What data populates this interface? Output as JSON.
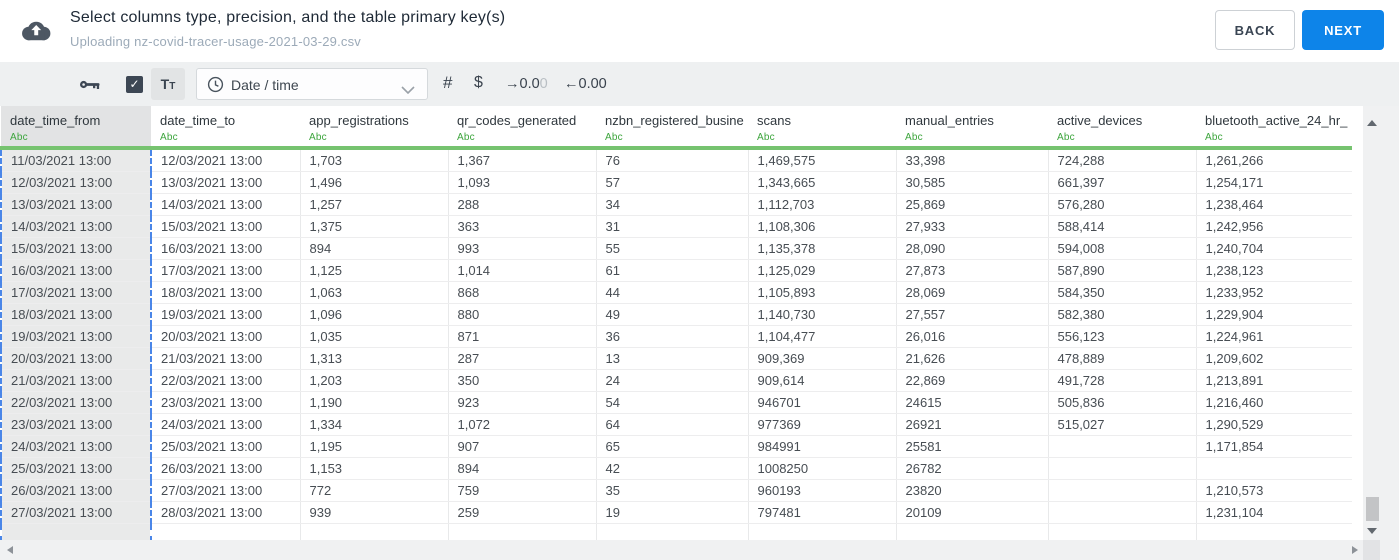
{
  "header": {
    "title": "Select columns type, precision, and the table primary key(s)",
    "subtitle": "Uploading nz-covid-tracer-usage-2021-03-29.csv",
    "back_label": "BACK",
    "next_label": "NEXT"
  },
  "toolbar": {
    "primary_key_icon": "key-icon",
    "checkbox_checked": true,
    "checkbox_glyph": "✓",
    "text_type_big": "T",
    "text_type_small": "T",
    "type_dropdown": {
      "icon": "clock-icon",
      "selected": "Date / time"
    },
    "number_label": "#",
    "currency_label": "$",
    "decimal_right": {
      "arrow": "→",
      "value": "0.0",
      "faded": "0"
    },
    "decimal_left": {
      "arrow": "←",
      "value": "0.00"
    }
  },
  "table": {
    "columns": [
      {
        "name": "date_time_from",
        "type": "Abc",
        "selected": true
      },
      {
        "name": "date_time_to",
        "type": "Abc",
        "selected": false
      },
      {
        "name": "app_registrations",
        "type": "Abc",
        "selected": false
      },
      {
        "name": "qr_codes_generated",
        "type": "Abc",
        "selected": false
      },
      {
        "name": "nzbn_registered_busine",
        "type": "Abc",
        "selected": false
      },
      {
        "name": "scans",
        "type": "Abc",
        "selected": false
      },
      {
        "name": "manual_entries",
        "type": "Abc",
        "selected": false
      },
      {
        "name": "active_devices",
        "type": "Abc",
        "selected": false
      },
      {
        "name": "bluetooth_active_24_hr_",
        "type": "Abc",
        "selected": false
      }
    ],
    "rows": [
      [
        "11/03/2021 13:00",
        "12/03/2021 13:00",
        "1,703",
        "1,367",
        "76",
        "1,469,575",
        "33,398",
        "724,288",
        "1,261,266"
      ],
      [
        "12/03/2021 13:00",
        "13/03/2021 13:00",
        "1,496",
        "1,093",
        "57",
        "1,343,665",
        "30,585",
        "661,397",
        "1,254,171"
      ],
      [
        "13/03/2021 13:00",
        "14/03/2021 13:00",
        "1,257",
        "288",
        "34",
        "1,112,703",
        "25,869",
        "576,280",
        "1,238,464"
      ],
      [
        "14/03/2021 13:00",
        "15/03/2021 13:00",
        "1,375",
        "363",
        "31",
        "1,108,306",
        "27,933",
        "588,414",
        "1,242,956"
      ],
      [
        "15/03/2021 13:00",
        "16/03/2021 13:00",
        "894",
        "993",
        "55",
        "1,135,378",
        "28,090",
        "594,008",
        "1,240,704"
      ],
      [
        "16/03/2021 13:00",
        "17/03/2021 13:00",
        "1,125",
        "1,014",
        "61",
        "1,125,029",
        "27,873",
        "587,890",
        "1,238,123"
      ],
      [
        "17/03/2021 13:00",
        "18/03/2021 13:00",
        "1,063",
        "868",
        "44",
        "1,105,893",
        "28,069",
        "584,350",
        "1,233,952"
      ],
      [
        "18/03/2021 13:00",
        "19/03/2021 13:00",
        "1,096",
        "880",
        "49",
        "1,140,730",
        "27,557",
        "582,380",
        "1,229,904"
      ],
      [
        "19/03/2021 13:00",
        "20/03/2021 13:00",
        "1,035",
        "871",
        "36",
        "1,104,477",
        "26,016",
        "556,123",
        "1,224,961"
      ],
      [
        "20/03/2021 13:00",
        "21/03/2021 13:00",
        "1,313",
        "287",
        "13",
        "909,369",
        "21,626",
        "478,889",
        "1,209,602"
      ],
      [
        "21/03/2021 13:00",
        "22/03/2021 13:00",
        "1,203",
        "350",
        "24",
        "909,614",
        "22,869",
        "491,728",
        "1,213,891"
      ],
      [
        "22/03/2021 13:00",
        "23/03/2021 13:00",
        "1,190",
        "923",
        "54",
        "946701",
        "24615",
        "505,836",
        "1,216,460"
      ],
      [
        "23/03/2021 13:00",
        "24/03/2021 13:00",
        "1,334",
        "1,072",
        "64",
        "977369",
        "26921",
        "515,027",
        "1,290,529"
      ],
      [
        "24/03/2021 13:00",
        "25/03/2021 13:00",
        "1,195",
        "907",
        "65",
        "984991",
        "25581",
        "",
        "1,171,854"
      ],
      [
        "25/03/2021 13:00",
        "26/03/2021 13:00",
        "1,153",
        "894",
        "42",
        "1008250",
        "26782",
        "",
        ""
      ],
      [
        "26/03/2021 13:00",
        "27/03/2021 13:00",
        "772",
        "759",
        "35",
        "960193",
        "23820",
        "",
        "1,210,573"
      ],
      [
        "27/03/2021 13:00",
        "28/03/2021 13:00",
        "939",
        "259",
        "19",
        "797481",
        "20109",
        "",
        "1,231,104"
      ]
    ]
  },
  "colors": {
    "accent_blue": "#0d84e9",
    "selection_dashed_blue": "#4a86e8",
    "type_green": "#3da53d",
    "header_underline_green": "#76c36f"
  }
}
